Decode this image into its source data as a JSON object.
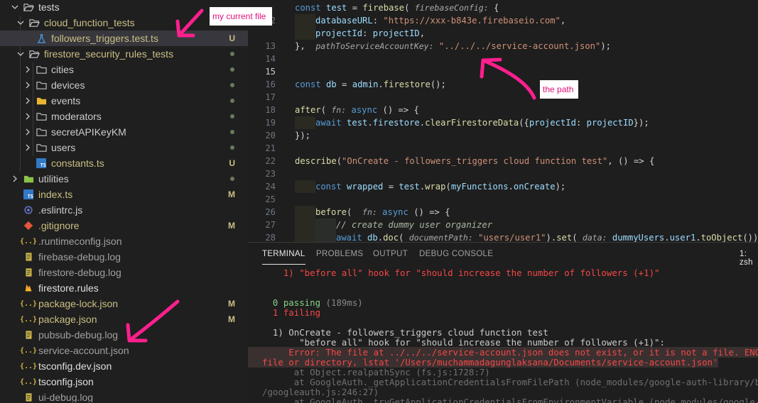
{
  "explorer": {
    "items": [
      {
        "label": "tests",
        "depth": 0,
        "kind": "folder-open",
        "color": "#d8d8d8",
        "badge": "",
        "dot": false,
        "selected": false
      },
      {
        "label": "cloud_function_tests",
        "depth": 1,
        "kind": "folder-open",
        "color": "#cbbf84",
        "badge": "",
        "dot": true,
        "selected": false
      },
      {
        "label": "followers_triggers.test.ts",
        "depth": 2,
        "kind": "test",
        "color": "#cbbf84",
        "badge": "U",
        "dot": false,
        "selected": true
      },
      {
        "label": "firestore_security_rules_tests",
        "depth": 1,
        "kind": "folder-open",
        "color": "#cbbf84",
        "badge": "",
        "dot": true,
        "selected": false
      },
      {
        "label": "cities",
        "depth": 2,
        "kind": "folder",
        "color": "#cccccc",
        "badge": "",
        "dot": true,
        "selected": false
      },
      {
        "label": "devices",
        "depth": 2,
        "kind": "folder",
        "color": "#cccccc",
        "badge": "",
        "dot": true,
        "selected": false
      },
      {
        "label": "events",
        "depth": 2,
        "kind": "folder-special",
        "color": "#cccccc",
        "badge": "",
        "dot": true,
        "selected": false
      },
      {
        "label": "moderators",
        "depth": 2,
        "kind": "folder",
        "color": "#cccccc",
        "badge": "",
        "dot": true,
        "selected": false
      },
      {
        "label": "secretAPIKeyKM",
        "depth": 2,
        "kind": "folder",
        "color": "#cccccc",
        "badge": "",
        "dot": true,
        "selected": false
      },
      {
        "label": "users",
        "depth": 2,
        "kind": "folder",
        "color": "#cccccc",
        "badge": "",
        "dot": true,
        "selected": false
      },
      {
        "label": "constants.ts",
        "depth": 2,
        "kind": "ts",
        "color": "#cbbf84",
        "badge": "U",
        "dot": false,
        "selected": false
      },
      {
        "label": "utilities",
        "depth": 0,
        "kind": "folder-green",
        "color": "#cccccc",
        "badge": "",
        "dot": true,
        "selected": false
      },
      {
        "label": "index.ts",
        "depth": 0,
        "kind": "ts",
        "color": "#cbbf84",
        "badge": "M",
        "dot": false,
        "selected": false
      },
      {
        "label": ".eslintrc.js",
        "depth": 0,
        "kind": "eslint",
        "color": "#cccccc",
        "badge": "",
        "dot": false,
        "selected": false
      },
      {
        "label": ".gitignore",
        "depth": 0,
        "kind": "git",
        "color": "#cbbf84",
        "badge": "M",
        "dot": false,
        "selected": false
      },
      {
        "label": ".runtimeconfig.json",
        "depth": 0,
        "kind": "json",
        "color": "#a0a0a0",
        "badge": "",
        "dot": false,
        "selected": false
      },
      {
        "label": "firebase-debug.log",
        "depth": 0,
        "kind": "log",
        "color": "#a0a0a0",
        "badge": "",
        "dot": false,
        "selected": false
      },
      {
        "label": "firestore-debug.log",
        "depth": 0,
        "kind": "log",
        "color": "#a0a0a0",
        "badge": "",
        "dot": false,
        "selected": false
      },
      {
        "label": "firestore.rules",
        "depth": 0,
        "kind": "firebase",
        "color": "#e0e0e0",
        "badge": "",
        "dot": false,
        "selected": false
      },
      {
        "label": "package-lock.json",
        "depth": 0,
        "kind": "json",
        "color": "#cbbf84",
        "badge": "M",
        "dot": false,
        "selected": false
      },
      {
        "label": "package.json",
        "depth": 0,
        "kind": "json",
        "color": "#cbbf84",
        "badge": "M",
        "dot": false,
        "selected": false
      },
      {
        "label": "pubsub-debug.log",
        "depth": 0,
        "kind": "log",
        "color": "#a0a0a0",
        "badge": "",
        "dot": false,
        "selected": false
      },
      {
        "label": "service-account.json",
        "depth": 0,
        "kind": "json",
        "color": "#a0a0a0",
        "badge": "",
        "dot": false,
        "selected": false
      },
      {
        "label": "tsconfig.dev.json",
        "depth": 0,
        "kind": "json",
        "color": "#e0e0e0",
        "badge": "",
        "dot": false,
        "selected": false
      },
      {
        "label": "tsconfig.json",
        "depth": 0,
        "kind": "json",
        "color": "#e0e0e0",
        "badge": "",
        "dot": false,
        "selected": false
      },
      {
        "label": "ui-debug.log",
        "depth": 0,
        "kind": "log",
        "color": "#a0a0a0",
        "badge": "",
        "dot": false,
        "selected": false
      }
    ]
  },
  "editor": {
    "active_line": "15",
    "lines": [
      {
        "n": "",
        "indent": 0,
        "tokens": [
          [
            "k",
            "const "
          ],
          [
            "v",
            "test"
          ],
          [
            "p",
            " = "
          ],
          [
            "f",
            "firebase"
          ],
          [
            "p",
            "( "
          ],
          [
            "h",
            "firebaseConfig:"
          ],
          [
            "p",
            " {"
          ]
        ]
      },
      {
        "n": "12",
        "indent": 1,
        "tokens": [
          [
            "v",
            "databaseURL"
          ],
          [
            "p",
            ": "
          ],
          [
            "s",
            "\"https://xxx-b843e.firebaseio.com\""
          ],
          [
            "p",
            ","
          ]
        ]
      },
      {
        "n": "",
        "indent": 1,
        "tokens": [
          [
            "v",
            "projectId"
          ],
          [
            "p",
            ": "
          ],
          [
            "v",
            "projectID"
          ],
          [
            "p",
            ","
          ]
        ]
      },
      {
        "n": "13",
        "indent": 0,
        "tokens": [
          [
            "p",
            "},  "
          ],
          [
            "h",
            "pathToServiceAccountKey:"
          ],
          [
            "p",
            " "
          ],
          [
            "s",
            "\"../../../service-account.json\""
          ],
          [
            "p",
            ");"
          ]
        ]
      },
      {
        "n": "14",
        "indent": 0,
        "tokens": []
      },
      {
        "n": "15",
        "indent": 0,
        "tokens": []
      },
      {
        "n": "16",
        "indent": 0,
        "tokens": [
          [
            "k",
            "const "
          ],
          [
            "v",
            "db"
          ],
          [
            "p",
            " = "
          ],
          [
            "v",
            "admin"
          ],
          [
            "p",
            "."
          ],
          [
            "f",
            "firestore"
          ],
          [
            "p",
            "();"
          ]
        ]
      },
      {
        "n": "17",
        "indent": 0,
        "tokens": []
      },
      {
        "n": "18",
        "indent": 0,
        "tokens": [
          [
            "f",
            "after"
          ],
          [
            "p",
            "( "
          ],
          [
            "h",
            "fn:"
          ],
          [
            "p",
            " "
          ],
          [
            "k",
            "async"
          ],
          [
            "p",
            " () => {"
          ]
        ]
      },
      {
        "n": "19",
        "indent": 1,
        "tokens": [
          [
            "k",
            "await "
          ],
          [
            "v",
            "test"
          ],
          [
            "p",
            "."
          ],
          [
            "v",
            "firestore"
          ],
          [
            "p",
            "."
          ],
          [
            "f",
            "clearFirestoreData"
          ],
          [
            "p",
            "({"
          ],
          [
            "v",
            "projectId"
          ],
          [
            "p",
            ": "
          ],
          [
            "v",
            "projectID"
          ],
          [
            "p",
            "});"
          ]
        ]
      },
      {
        "n": "20",
        "indent": 0,
        "tokens": [
          [
            "p",
            "});"
          ]
        ]
      },
      {
        "n": "21",
        "indent": 0,
        "tokens": []
      },
      {
        "n": "22",
        "indent": 0,
        "tokens": [
          [
            "f",
            "describe"
          ],
          [
            "p",
            "("
          ],
          [
            "s",
            "\"OnCreate - followers_triggers cloud function test\""
          ],
          [
            "p",
            ", () => {"
          ]
        ]
      },
      {
        "n": "23",
        "indent": 0,
        "tokens": []
      },
      {
        "n": "24",
        "indent": 1,
        "tokens": [
          [
            "k",
            "const "
          ],
          [
            "v",
            "wrapped"
          ],
          [
            "p",
            " = "
          ],
          [
            "v",
            "test"
          ],
          [
            "p",
            "."
          ],
          [
            "f",
            "wrap"
          ],
          [
            "p",
            "("
          ],
          [
            "v",
            "myFunctions"
          ],
          [
            "p",
            "."
          ],
          [
            "v",
            "onCreate"
          ],
          [
            "p",
            ");"
          ]
        ]
      },
      {
        "n": "25",
        "indent": 0,
        "tokens": []
      },
      {
        "n": "26",
        "indent": 1,
        "tokens": [
          [
            "f",
            "before"
          ],
          [
            "p",
            "(  "
          ],
          [
            "h",
            "fn:"
          ],
          [
            "p",
            " "
          ],
          [
            "k",
            "async"
          ],
          [
            "p",
            " () => {"
          ]
        ]
      },
      {
        "n": "27",
        "indent": 2,
        "tokens": [
          [
            "c",
            "// create dummy user organizer"
          ]
        ]
      },
      {
        "n": "28",
        "indent": 2,
        "tokens": [
          [
            "k",
            "await "
          ],
          [
            "v",
            "db"
          ],
          [
            "p",
            "."
          ],
          [
            "f",
            "doc"
          ],
          [
            "p",
            "( "
          ],
          [
            "h",
            "documentPath:"
          ],
          [
            "p",
            " "
          ],
          [
            "s",
            "\"users/user1\""
          ],
          [
            "p",
            ")."
          ],
          [
            "f",
            "set"
          ],
          [
            "p",
            "( "
          ],
          [
            "h",
            "data:"
          ],
          [
            "p",
            " "
          ],
          [
            "v",
            "dummyUsers"
          ],
          [
            "p",
            "."
          ],
          [
            "v",
            "user1"
          ],
          [
            "p",
            "."
          ],
          [
            "f",
            "toObject"
          ],
          [
            "p",
            "());"
          ]
        ]
      }
    ]
  },
  "panel": {
    "tabs": [
      "TERMINAL",
      "PROBLEMS",
      "OUTPUT",
      "DEBUG CONSOLE"
    ],
    "active_tab": "TERMINAL",
    "shell_label": "1: zsh",
    "lines": [
      {
        "text": "    1) \"before all\" hook for \"should increase the number of followers (+1)\"",
        "style": "t-red",
        "bg": false
      },
      {
        "text": "",
        "style": "t-white",
        "bg": false
      },
      {
        "text": "",
        "style": "t-white",
        "bg": false
      },
      {
        "text": "  0 passing ",
        "style": "t-green",
        "suffix": "(189ms)",
        "bg": false
      },
      {
        "text": "  1 failing",
        "style": "t-red",
        "bg": false
      },
      {
        "text": "",
        "style": "t-white",
        "bg": false
      },
      {
        "text": "  1) OnCreate - followers_triggers cloud function test",
        "style": "t-white",
        "bg": false
      },
      {
        "text": "       \"before all\" hook for \"should increase the number of followers (+1)\":",
        "style": "t-white",
        "bg": false
      },
      {
        "text": "     Error: The file at ../../../service-account.json does not exist, or it is not a file. ENOENT: no such",
        "style": "t-red",
        "bg": true
      },
      {
        "text": "file or directory, lstat '/Users/muchammadagunglaksana/Documents/service-account.json'",
        "style": "t-red",
        "bg": true
      },
      {
        "text": "      at Object.realpathSync (fs.js:1728:7)",
        "style": "t-dim",
        "bg": false
      },
      {
        "text": "      at GoogleAuth._getApplicationCredentialsFromFilePath (node_modules/google-auth-library/build/src/auth",
        "style": "t-dim",
        "bg": false
      },
      {
        "text": "/googleauth.js:246:27)",
        "style": "t-dim",
        "bg": false
      },
      {
        "text": "      at GoogleAuth._tryGetApplicationCredentialsFromEnvironmentVariable (node_modules/google-auth-library",
        "style": "t-dim",
        "bg": false
      }
    ]
  },
  "annotations": {
    "current_file": "my current file",
    "the_path": "the path",
    "arrow_color": "#ff1f8e"
  }
}
